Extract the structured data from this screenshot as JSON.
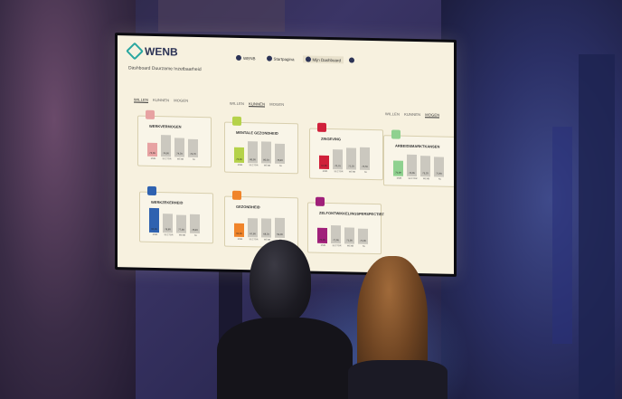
{
  "dashboard": {
    "brand": "WENB",
    "subtitle": "Dashboard Duurzame Inzetbaarheid",
    "nav": {
      "user": "WENB",
      "home": "Startpagina",
      "dashboard": "Mijn Dashboard"
    },
    "tabs": [
      "WILLEN",
      "KUNNEN",
      "MOGEN"
    ],
    "cards": [
      {
        "title": "WERKVERMOGEN",
        "color": "#e7a2a2",
        "bars": [
          {
            "label": "MIJN",
            "value": "73,09",
            "h": 0.55,
            "highlight": true
          },
          {
            "label": "SECTOR",
            "value": "74,90",
            "h": 0.85
          },
          {
            "label": "WENB",
            "value": "74,20",
            "h": 0.75
          },
          {
            "label": "NL",
            "value": "74,70",
            "h": 0.7
          }
        ]
      },
      {
        "title": "MENTALE GEZONDHEID",
        "color": "#b5d24a",
        "bars": [
          {
            "label": "MIJN",
            "value": "76,00",
            "h": 0.6,
            "highlight": true
          },
          {
            "label": "SECTOR",
            "value": "80,00",
            "h": 0.85
          },
          {
            "label": "WENB",
            "value": "80,10",
            "h": 0.85
          },
          {
            "label": "NL",
            "value": "78,40",
            "h": 0.78
          }
        ]
      },
      {
        "title": "ZINGEVING",
        "color": "#d0203a",
        "bars": [
          {
            "label": "MIJN",
            "value": "62,80",
            "h": 0.55,
            "highlight": true
          },
          {
            "label": "SECTOR",
            "value": "70,70",
            "h": 0.8
          },
          {
            "label": "WENB",
            "value": "72,20",
            "h": 0.85
          },
          {
            "label": "NL",
            "value": "73,50",
            "h": 0.9
          }
        ]
      },
      {
        "title": "ARBEIDSMARKTKANSEN",
        "color": "#8fd18f",
        "bars": [
          {
            "label": "MIJN",
            "value": "70,09",
            "h": 0.6,
            "highlight": true
          },
          {
            "label": "SECTOR",
            "value": "74,06",
            "h": 0.85
          },
          {
            "label": "WENB",
            "value": "73,20",
            "h": 0.82
          },
          {
            "label": "NL",
            "value": "71,40",
            "h": 0.78
          }
        ]
      },
      {
        "title": "WERKZEKERHEID",
        "color": "#2f62b0",
        "bars": [
          {
            "label": "MIJN",
            "value": "90,00",
            "h": 0.95,
            "highlight": true
          },
          {
            "label": "SECTOR",
            "value": "78,80",
            "h": 0.75
          },
          {
            "label": "WENB",
            "value": "77,30",
            "h": 0.7
          },
          {
            "label": "NL",
            "value": "78,40",
            "h": 0.75
          }
        ]
      },
      {
        "title": "GEZONDHEID",
        "color": "#f0842a",
        "bars": [
          {
            "label": "MIJN",
            "value": "60,00",
            "h": 0.55,
            "highlight": true
          },
          {
            "label": "SECTOR",
            "value": "67,90",
            "h": 0.75
          },
          {
            "label": "WENB",
            "value": "68,20",
            "h": 0.75
          },
          {
            "label": "NL",
            "value": "69,00",
            "h": 0.78
          }
        ]
      },
      {
        "title": "ZELFONTWIKKELINGSPERSPECTIEF",
        "color": "#a0207a",
        "bars": [
          {
            "label": "MIJN",
            "value": "70,00",
            "h": 0.6,
            "highlight": true
          },
          {
            "label": "SECTOR",
            "value": "72,00",
            "h": 0.7
          },
          {
            "label": "WENB",
            "value": "71,00",
            "h": 0.65
          },
          {
            "label": "NL",
            "value": "71,00",
            "h": 0.62
          }
        ]
      }
    ]
  }
}
